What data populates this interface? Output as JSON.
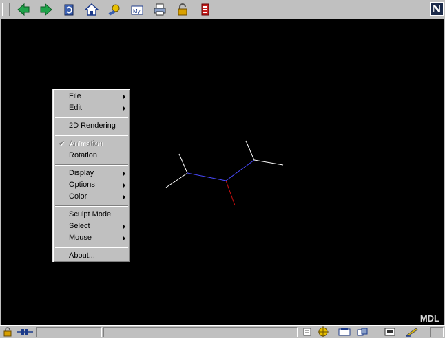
{
  "toolbar": {
    "buttons": [
      "back-icon",
      "forward-icon",
      "reload-icon",
      "home-icon",
      "search-icon",
      "my-netscape-icon",
      "print-icon",
      "security-lock-icon",
      "stop-icon"
    ]
  },
  "brand": {
    "logo_letter": "N"
  },
  "viewport": {
    "watermark": "MDL"
  },
  "context_menu": {
    "items": [
      {
        "label": "File",
        "submenu": true
      },
      {
        "label": "Edit",
        "submenu": true
      },
      {
        "label": "2D Rendering",
        "submenu": false
      },
      {
        "label": "Animation",
        "submenu": false,
        "disabled": true,
        "checked": true
      },
      {
        "label": "Rotation",
        "submenu": false
      },
      {
        "label": "Display",
        "submenu": true
      },
      {
        "label": "Options",
        "submenu": true
      },
      {
        "label": "Color",
        "submenu": true
      },
      {
        "label": "Sculpt Mode",
        "submenu": false
      },
      {
        "label": "Select",
        "submenu": true
      },
      {
        "label": "Mouse",
        "submenu": true
      },
      {
        "label": "About...",
        "submenu": false
      }
    ]
  },
  "colors": {
    "background": "#000000",
    "bond_white": "#ffffff",
    "bond_blue": "#3a3aff",
    "bond_red": "#d01010",
    "chrome": "#c0c0c0"
  }
}
